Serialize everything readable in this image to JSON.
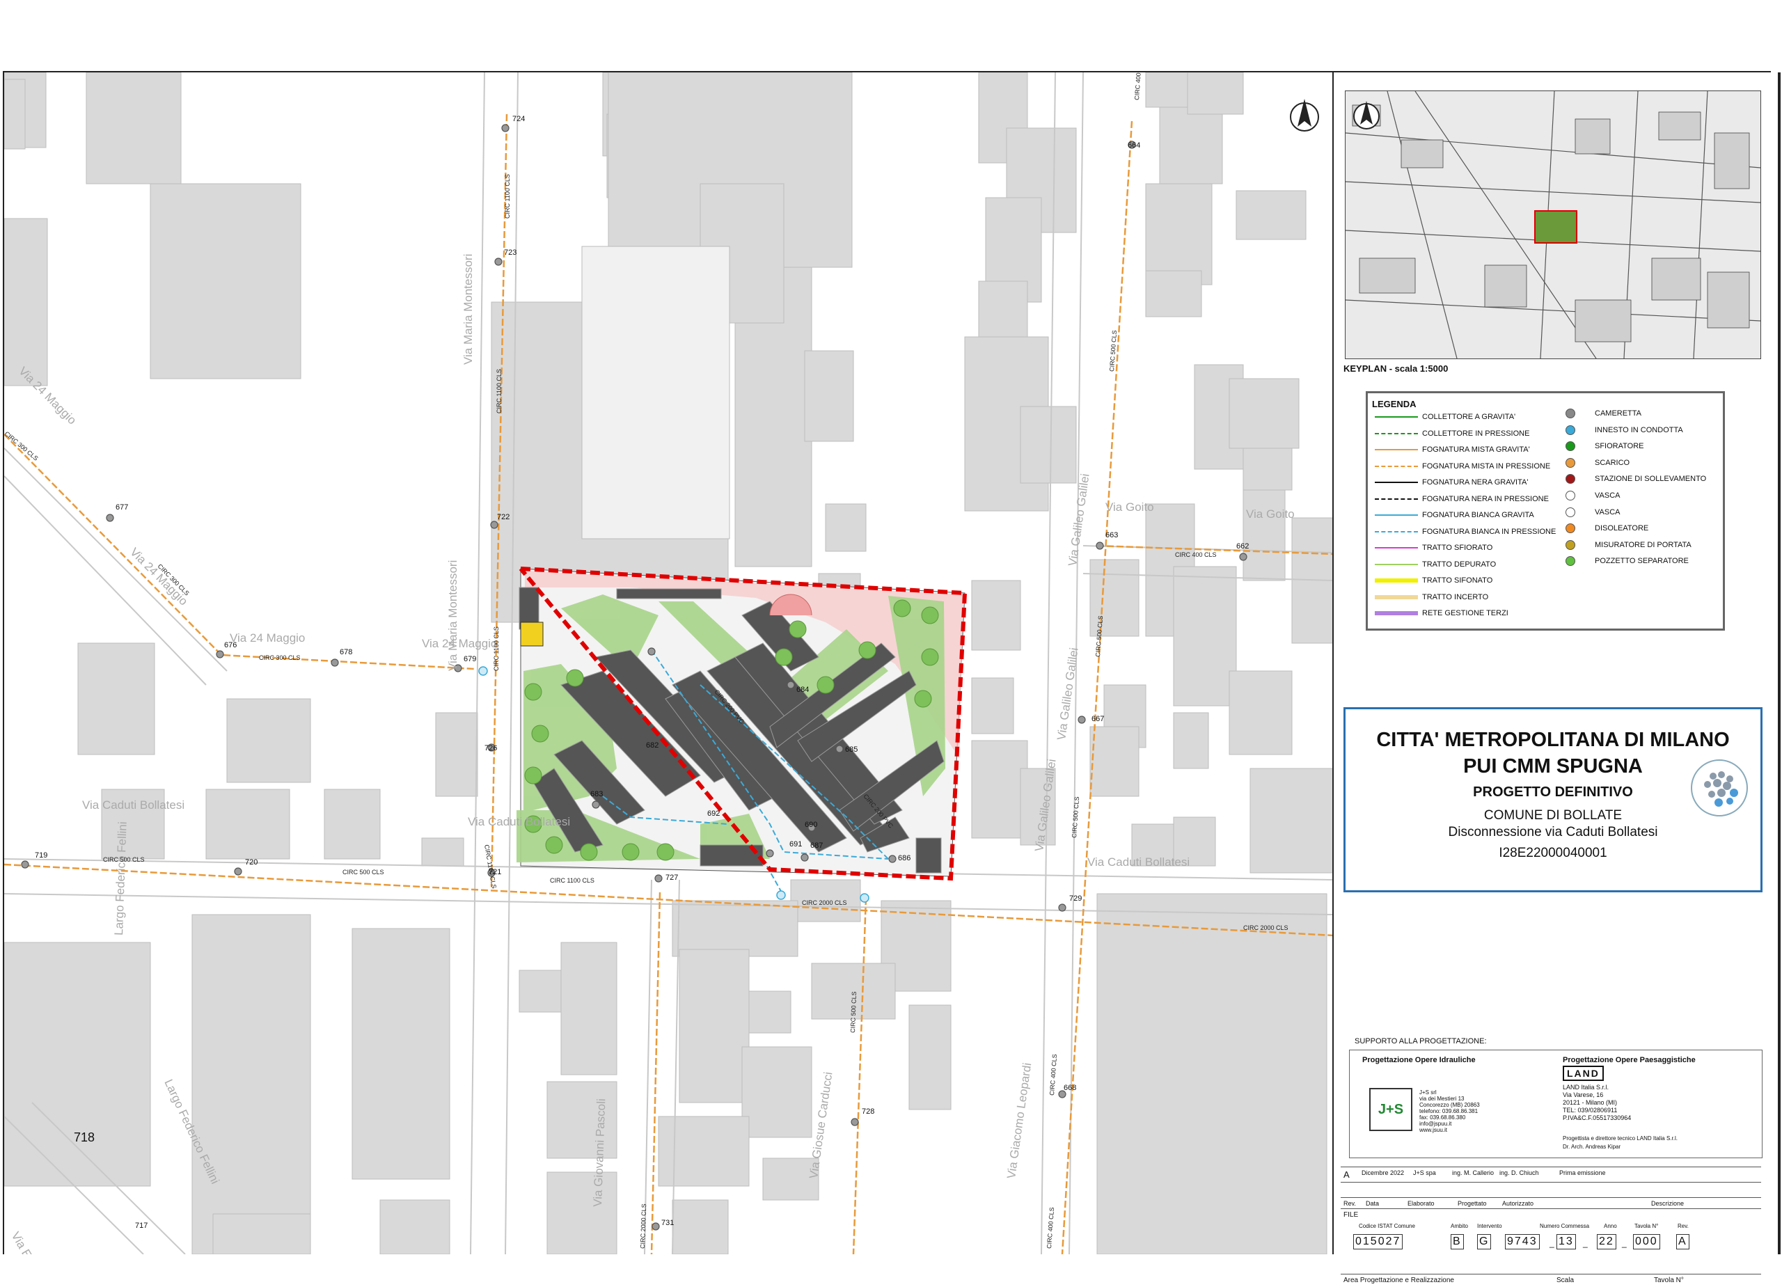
{
  "map": {
    "street_labels": [
      "Via Maria Montessori",
      "Via Maria Montessori",
      "Via 24 Maggio",
      "Via 24 Maggio",
      "Via 24 Maggio",
      "Via 24 Maggio",
      "Via Caduti Bollatesi",
      "Via Caduti Bollatesi",
      "Via Caduti Bollatesi",
      "Via Galileo Galilei",
      "Via Galileo Galilei",
      "Via Galileo Galilei",
      "Via Goito",
      "Via Goito",
      "Largo Federico Fellini",
      "Largo Federico Fellini",
      "Via Giovanni Pascoli",
      "Via Giosue Carducci",
      "Via Giacomo Leopardi",
      "Via Enrico"
    ],
    "pipe_labels": [
      "CIRC 1100 CLS",
      "CIRC 1100 CLS",
      "CIRC 1100 CLS",
      "CIRC 1100 CLS",
      "CIRC 300 CLS",
      "CIRC 300 CLS",
      "CIRC 300 CLS",
      "CIRC 500 CLS",
      "CIRC 500 CLS",
      "CIRC 1100 CLS",
      "CIRC 2000 CLS",
      "CIRC 2000 CLS",
      "CIRC 400 CLS",
      "CIRC 400 CLS",
      "CIRC 400 CLS",
      "CIRC 500 CLS",
      "CIRC 500 CLS",
      "CIRC 500 CLS",
      "CIRC 400 CLS",
      "CIRC 2000 CLS",
      "CIRC 500 CLS",
      "CIRC 200 PVC",
      "CIRC 200 PVC"
    ],
    "node_ids": [
      "724",
      "723",
      "722",
      "726",
      "721",
      "727",
      "676",
      "677",
      "678",
      "679",
      "719",
      "720",
      "664",
      "663",
      "662",
      "667",
      "729",
      "668",
      "728",
      "731",
      "717",
      "718",
      "682",
      "683",
      "684",
      "685",
      "686",
      "687",
      "690",
      "691",
      "692"
    ]
  },
  "keyplan": {
    "title": "KEYPLAN - scala 1:5000"
  },
  "legend": {
    "title": "LEGENDA",
    "lines": [
      {
        "label": "COLLETTORE A GRAVITA'",
        "color": "#1a9a1a",
        "style": "solid"
      },
      {
        "label": "COLLETTORE IN PRESSIONE",
        "color": "#1a9a1a",
        "style": "dashed"
      },
      {
        "label": "FOGNATURA MISTA GRAVITA'",
        "color": "#e89a3a",
        "style": "solid"
      },
      {
        "label": "FOGNATURA MISTA IN PRESSIONE",
        "color": "#e89a3a",
        "style": "dashed"
      },
      {
        "label": "FOGNATURA NERA GRAVITA'",
        "color": "#111111",
        "style": "solid"
      },
      {
        "label": "FOGNATURA NERA IN PRESSIONE",
        "color": "#111111",
        "style": "dashed"
      },
      {
        "label": "FOGNATURA BIANCA GRAVITA",
        "color": "#3aaad8",
        "style": "solid"
      },
      {
        "label": "FOGNATURA BIANCA IN PRESSIONE",
        "color": "#3aaad8",
        "style": "dashed"
      },
      {
        "label": "TRATTO SFIORATO",
        "color": "#d83ad0",
        "style": "solid"
      },
      {
        "label": "TRATTO DEPURATO",
        "color": "#a0d060",
        "style": "solid"
      },
      {
        "label": "TRATTO SIFONATO",
        "color": "#f0f000",
        "style": "thick"
      },
      {
        "label": "TRATTO INCERTO",
        "color": "#f0d898",
        "style": "thick"
      },
      {
        "label": "RETE GESTIONE TERZI",
        "color": "#b080e0",
        "style": "thick"
      }
    ],
    "symbols": [
      {
        "label": "CAMERETTA",
        "color": "#888888"
      },
      {
        "label": "INNESTO IN CONDOTTA",
        "color": "#3aaad8"
      },
      {
        "label": "SFIORATORE",
        "color": "#1a9a1a"
      },
      {
        "label": "SCARICO",
        "color": "#e89a3a"
      },
      {
        "label": "STAZIONE DI SOLLEVAMENTO",
        "color": "#a01818"
      },
      {
        "label": "VASCA",
        "color": "#ffffff"
      },
      {
        "label": "VASCA",
        "color": "#ffffff"
      },
      {
        "label": "DISOLEATORE",
        "color": "#f08a20"
      },
      {
        "label": "MISURATORE DI PORTATA",
        "color": "#c0a020"
      },
      {
        "label": "POZZETTO SEPARATORE",
        "color": "#60c040"
      }
    ]
  },
  "title_block": {
    "line1": "CITTA' METROPOLITANA DI MILANO",
    "line2": "PUI CMM SPUGNA",
    "line3": "PROGETTO DEFINITIVO",
    "line4": "COMUNE DI BOLLATE",
    "line5": "Disconnessione via Caduti Bollatesi",
    "line6": "I28E22000040001"
  },
  "support": {
    "title": "SUPPORTO ALLA PROGETTAZIONE:",
    "left_head": "Progettazione Opere Idrauliche",
    "right_head": "Progettazione Opere Paesaggistiche",
    "js_logo": "J+S",
    "js_lines": [
      "J+S  srl",
      "via dei Mestieri 13",
      "Concorezzo (MB) 20863",
      "telefono: 039.68.86.381",
      "fax: 039.68.86.380",
      "info@jspuu.it",
      "www.jsuu.it"
    ],
    "land_logo": "LAND",
    "land_lines": [
      "LAND Italia S.r.l.",
      "Via Varese, 16",
      "20121 - Milano (MI)",
      "TEL: 039/02806911",
      "P.IVA&C.F.05517330964"
    ],
    "land_note1": "Progettista e direttore tecnico LAND Italia S.r.l.",
    "land_note2": "Dr. Arch. Andreas Kipar"
  },
  "revisions": {
    "row": {
      "rev": "A",
      "date": "Dicembre 2022",
      "by": "J+S spa",
      "checked": "ing. M. Callerio",
      "approved": "ing. D. Chiuch",
      "desc": "Prima emissione"
    },
    "headers": [
      "Rev.",
      "Data",
      "Elaborato",
      "Progettato",
      "Autorizzato",
      "Descrizione"
    ]
  },
  "file_row": {
    "label": "FILE",
    "heads": [
      "Codice ISTAT Comune",
      "Ambito",
      "Intervento",
      "Numero Commessa",
      "Anno",
      "Tavola N°",
      "Rev."
    ],
    "istat": "015027",
    "ambito": "B",
    "intervento": "G",
    "commessa_a": "9743",
    "commessa_b": "13",
    "anno": "22",
    "tavola": "000",
    "rev": "A",
    "footer_left": "Area Progettazione e Realizzazione",
    "footer_mid": "Scala",
    "footer_right": "Tavola N°"
  }
}
